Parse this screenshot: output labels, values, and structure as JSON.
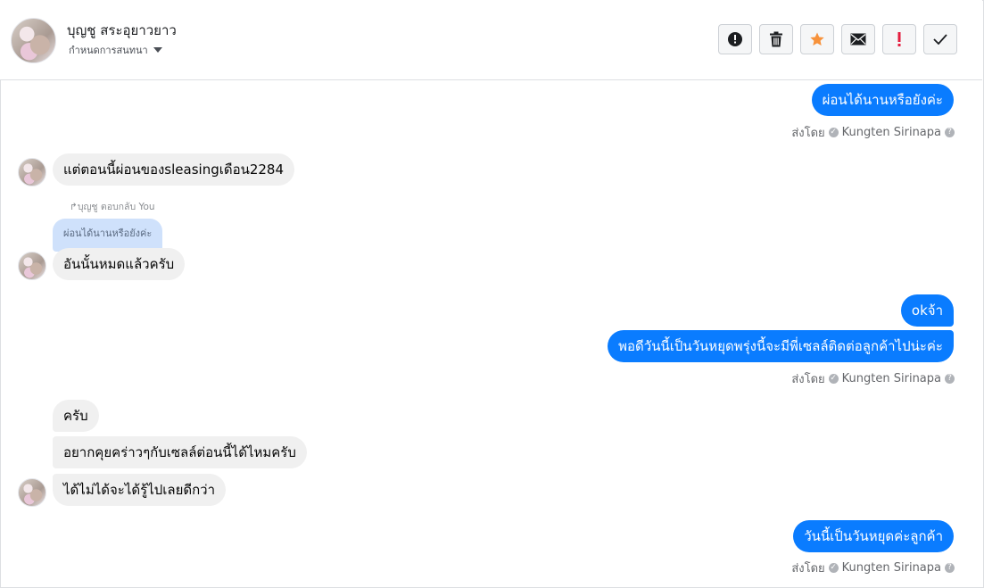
{
  "header": {
    "contact_name": "บุญชู สระอุยาวยาว",
    "subtitle": "กำหนดการสนทนา",
    "toolbar": [
      {
        "name": "report-button",
        "icon": "alert-circle-icon"
      },
      {
        "name": "delete-button",
        "icon": "trash-icon"
      },
      {
        "name": "star-button",
        "icon": "star-icon"
      },
      {
        "name": "mail-button",
        "icon": "envelope-icon"
      },
      {
        "name": "mark-important-button",
        "icon": "exclamation-icon"
      },
      {
        "name": "done-button",
        "icon": "check-icon"
      }
    ]
  },
  "colors": {
    "outgoing": "#0a7cff",
    "incoming": "#f0f0f0",
    "quoted": "#cfe1fb",
    "star": "#f7923b",
    "exclamation": "#e41e3f"
  },
  "thread": {
    "out_1": "ผ่อนได้นานหรือยังค่ะ",
    "sent_label": "ส่งโดย",
    "page_name": "Kungten Sirinapa",
    "in_1": "แต่ตอนนี้ผ่อนของsleasingเดือน2284",
    "reply_meta": "บุญชู ตอบกลับ You",
    "reply_quote": "ผ่อนได้นานหรือยังค่ะ",
    "in_2": "อันนั้นหมดแล้วครับ",
    "out_2": "okจ้า",
    "out_3": "พอดีวันนี้เป็นวันหยุดพรุ่งนี้จะมีพี่เซลล์ติดต่อลูกค้าไปน่ะค่ะ",
    "in_3": "ครับ",
    "in_4": "อยากคุยคร่าวๆกับเซลล์ต่อนนี้ได้ไหมครับ",
    "in_5": "ได้ไม่ได้จะได้รู้ไปเลยดีกว่า",
    "out_4": "วันนี้เป็นวันหยุดค่ะลูกค้า"
  }
}
